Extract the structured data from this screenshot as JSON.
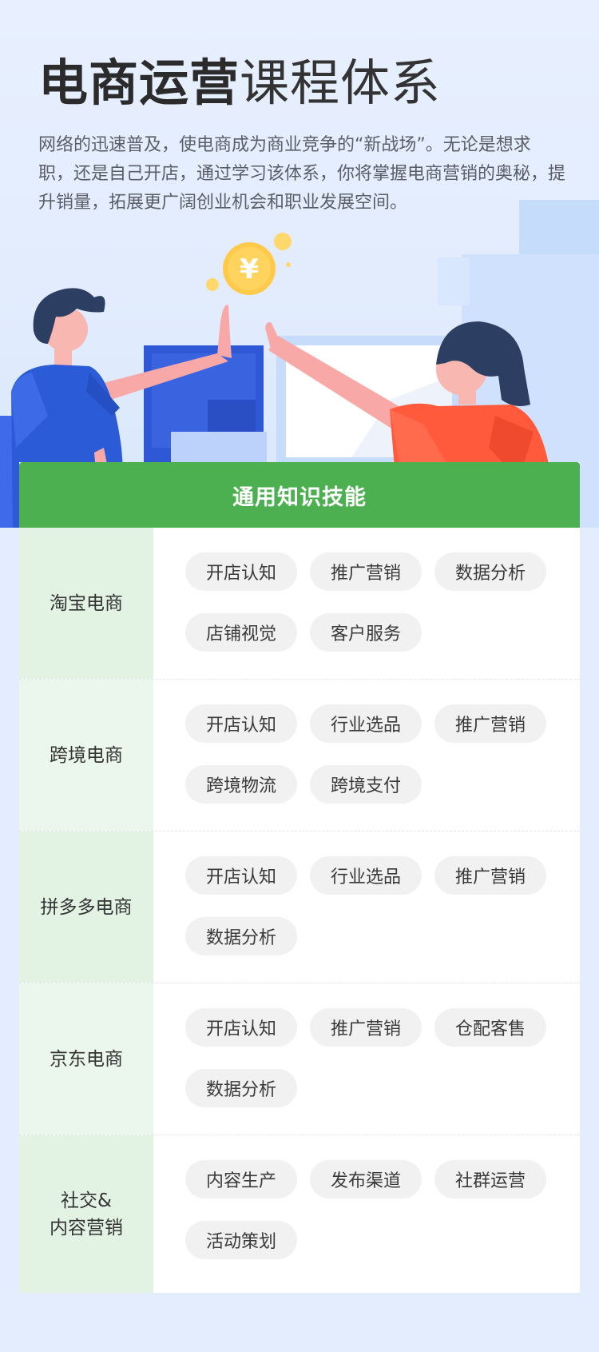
{
  "hero": {
    "title_bold": "电商运营",
    "title_light": "课程体系",
    "description": "网络的迅速普及，使电商成为商业竞争的“新战场”。无论是想求职，还是自己开店，通过学习该体系，你将掌握电商营销的奥秘，提升销量，拓展更广阔创业机会和职业发展空间。",
    "coin_symbol": "¥"
  },
  "card": {
    "header": "通用知识技能",
    "rows": [
      {
        "label": "淘宝电商",
        "tags": [
          "开店认知",
          "推广营销",
          "数据分析",
          "店铺视觉",
          "客户服务"
        ]
      },
      {
        "label": "跨境电商",
        "tags": [
          "开店认知",
          "行业选品",
          "推广营销",
          "跨境物流",
          "跨境支付"
        ]
      },
      {
        "label": "拼多多电商",
        "tags": [
          "开店认知",
          "行业选品",
          "推广营销",
          "数据分析"
        ]
      },
      {
        "label": "京东电商",
        "tags": [
          "开店认知",
          "推广营销",
          "仓配客售",
          "数据分析"
        ]
      },
      {
        "label": "社交&\n内容营销",
        "tags": [
          "内容生产",
          "发布渠道",
          "社群运营",
          "活动策划"
        ]
      }
    ]
  },
  "colors": {
    "header_green": "#4caf50",
    "label_bg_dark": "#e2f2e3",
    "label_bg_light": "#ebf6ec",
    "tag_bg": "#f1f1f1",
    "page_bg": "#e3edfd"
  },
  "icons": [
    "yen-coin-icon",
    "high-five-illustration"
  ]
}
